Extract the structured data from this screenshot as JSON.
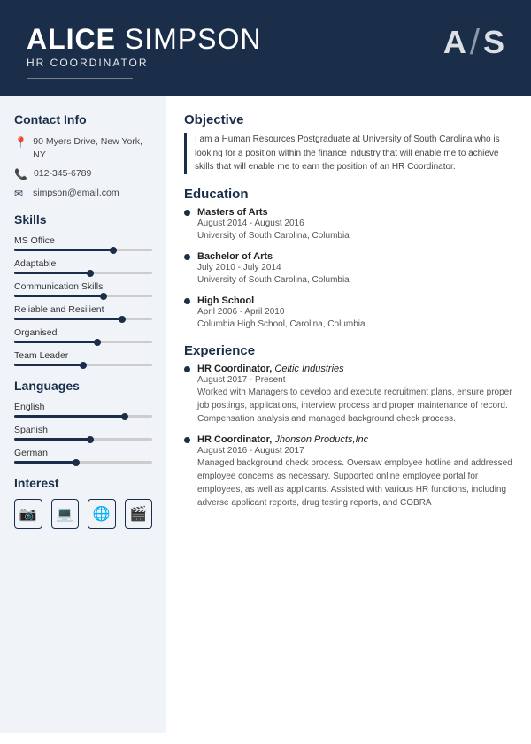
{
  "header": {
    "first_name": "ALICE",
    "last_name": "SIMPSON",
    "title": "HR COORDINATOR",
    "monogram_a": "A",
    "monogram_s": "S"
  },
  "sidebar": {
    "contact_title": "Contact Info",
    "contact": {
      "address": "90 Myers Drive, New York, NY",
      "phone": "012-345-6789",
      "email": "simpson@email.com"
    },
    "skills_title": "Skills",
    "skills": [
      {
        "label": "MS Office",
        "fill": 72,
        "dot": 72
      },
      {
        "label": "Adaptable",
        "fill": 55,
        "dot": 55
      },
      {
        "label": "Communication Skills",
        "fill": 65,
        "dot": 65
      },
      {
        "label": "Reliable and Resilient",
        "fill": 78,
        "dot": 78
      },
      {
        "label": "Organised",
        "fill": 60,
        "dot": 60
      },
      {
        "label": "Team Leader",
        "fill": 50,
        "dot": 50
      }
    ],
    "languages_title": "Languages",
    "languages": [
      {
        "label": "English",
        "fill": 80,
        "dot": 80
      },
      {
        "label": "Spanish",
        "fill": 55,
        "dot": 55
      },
      {
        "label": "German",
        "fill": 45,
        "dot": 45
      }
    ],
    "interest_title": "Interest",
    "interests": [
      {
        "icon": "📷",
        "name": "camera-icon"
      },
      {
        "icon": "💻",
        "name": "computer-icon"
      },
      {
        "icon": "🌐",
        "name": "globe-icon"
      },
      {
        "icon": "🎬",
        "name": "video-icon"
      }
    ]
  },
  "main": {
    "objective_title": "Objective",
    "objective_text": "I am a Human Resources Postgraduate at University of South Carolina who is looking for a position within the finance industry that will enable me to achieve skills that will enable me to earn the position of an HR Coordinator.",
    "education_title": "Education",
    "education": [
      {
        "degree": "Masters of Arts",
        "dates": "August 2014 - August 2016",
        "school": "University of South Carolina, Columbia"
      },
      {
        "degree": "Bachelor of Arts",
        "dates": "July 2010 - July 2014",
        "school": "University of South Carolina, Columbia"
      },
      {
        "degree": "High School",
        "dates": "April 2006 - April 2010",
        "school": "Columbia High School, Carolina, Columbia"
      }
    ],
    "experience_title": "Experience",
    "experience": [
      {
        "title": "HR Coordinator",
        "company": "Celtic Industries",
        "dates": "August 2017 - Present",
        "desc": "Worked with Managers to develop and execute recruitment plans, ensure proper job postings, applications, interview process and proper maintenance of record. Compensation analysis and managed background check process."
      },
      {
        "title": "HR Coordinator",
        "company": "Jhonson Products,Inc",
        "dates": "August 2016 - August 2017",
        "desc": "Managed background check process. Oversaw employee hotline and addressed employee concerns as necessary. Supported online employee portal for employees, as well as applicants. Assisted with various HR functions, including adverse applicant reports, drug testing reports, and COBRA"
      }
    ]
  }
}
